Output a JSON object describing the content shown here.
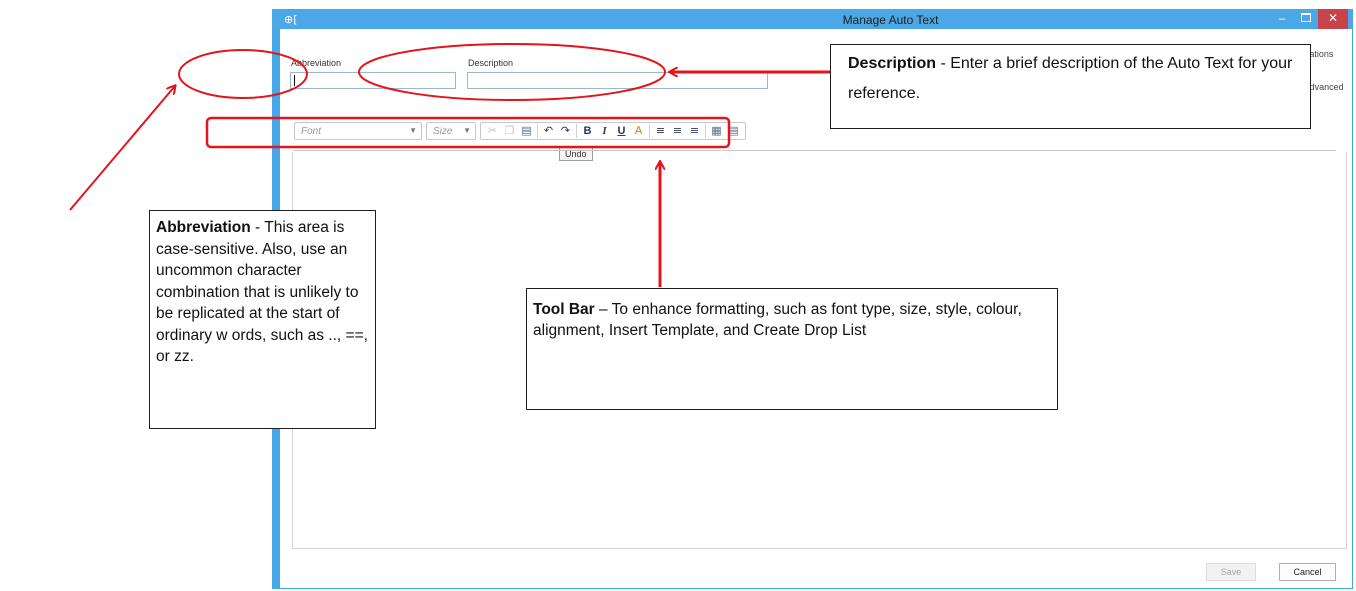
{
  "window": {
    "title": "Manage Auto Text",
    "app_icon": "⊕[",
    "minimize_glyph": "–",
    "close_glyph": "✕"
  },
  "form": {
    "abbreviation_label": "Abbreviation",
    "abbreviation_value": "",
    "description_label": "Description",
    "description_value": "",
    "show_notifications_label": "Show Auto Text Notifications",
    "show_notifications_checked": true,
    "show_advanced_label": "Show Advanced View",
    "show_advanced_checked": false
  },
  "toolbar": {
    "font_placeholder": "Font",
    "size_placeholder": "Size",
    "tooltip": "Undo",
    "icons": [
      "cut-icon",
      "copy-icon",
      "paste-icon",
      "undo-icon",
      "redo-icon",
      "bold-icon",
      "italic-icon",
      "underline-icon",
      "font-color-icon",
      "align-left-icon",
      "align-center-icon",
      "align-right-icon",
      "insert-template-icon",
      "create-drop-list-icon"
    ]
  },
  "footer": {
    "save_label": "Save",
    "cancel_label": "Cancel"
  },
  "annotations": {
    "abbreviation": {
      "heading": "Abbreviation",
      "text": " - This area is case-sensitive. Also, use an uncommon character combination that is unlikely to be replicated at the start of ordinary w ords, such as .., ==, or zz."
    },
    "description": {
      "heading": "Description",
      "text": " - Enter a brief description of the Auto Text for your reference."
    },
    "toolbar": {
      "heading": "Tool Bar",
      "text": " – To enhance formatting, such as font type, size, style, colour, alignment, Insert Template, and Create Drop List"
    },
    "colors": {
      "highlight": "#e3141b",
      "window_accent": "#4ca7e6"
    }
  }
}
